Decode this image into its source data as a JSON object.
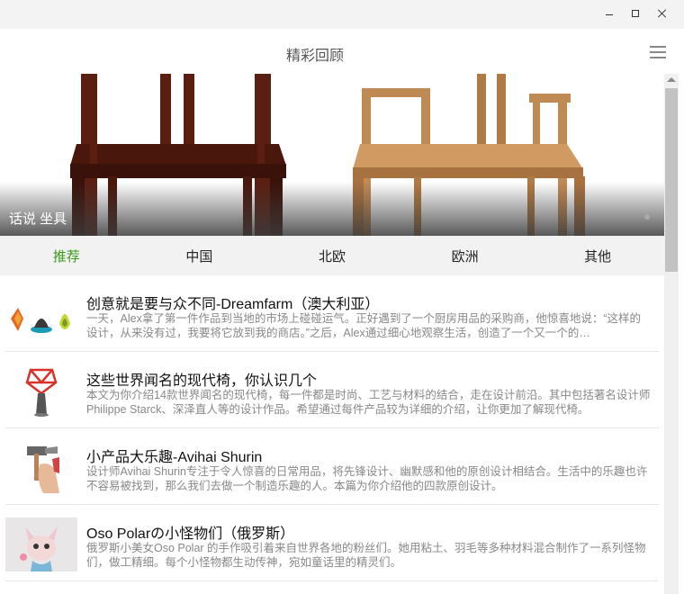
{
  "window": {
    "minimize_label": "–",
    "maximize_label": "□",
    "close_label": "×"
  },
  "header": {
    "title": "精彩回顾",
    "menu_icon": "hamburger-menu-icon"
  },
  "banner": {
    "caption": "话说 坐具",
    "image_subject": "two-wooden-chairs",
    "colors": {
      "dark_chair": "#5b1f12",
      "light_chair": "#c08a54"
    }
  },
  "tabs": [
    {
      "label": "推荐",
      "active": true
    },
    {
      "label": "中国",
      "active": false
    },
    {
      "label": "北欧",
      "active": false
    },
    {
      "label": "欧洲",
      "active": false
    },
    {
      "label": "其他",
      "active": false
    }
  ],
  "accent_color": "#3a9a1a",
  "articles": [
    {
      "title": "创意就是要与众不同-Dreamfarm（澳大利亚）",
      "desc": "一天，Alex拿了第一件作品到当地的市场上碰碰运气。正好遇到了一个厨房用品的采购商，他惊喜地说：“这样的设计，从来没有过，我要将它放到我的商店。”之后，Alex通过细心地观察生活，创造了一个又一个的…",
      "thumb_icon": "kitchen-gadgets-thumbnail"
    },
    {
      "title": "这些世界闻名的现代椅，你认识几个",
      "desc": "本文为你介绍14款世界闻名的现代椅，每一件都是时尚、工艺与材料的结合，走在设计前沿。其中包括著名设计师 Philippe Starck、深泽直人等的设计作品。希望通过每件产品较为详细的介绍，让你更加了解现代椅。",
      "thumb_icon": "red-chair-thumbnail"
    },
    {
      "title": "小产品大乐趣-Avihai Shurin",
      "desc": "设计师Avihai Shurin专注于令人惊喜的日常用品，将先锋设计、幽默感和他的原创设计相结合。生活中的乐趣也许不容易被找到，那么我们去做一个制造乐趣的人。本篇为你介绍他的四款原创设计。",
      "thumb_icon": "hammer-hand-thumbnail"
    },
    {
      "title": "Oso Polarの小怪物们（俄罗斯）",
      "desc": "俄罗斯小美女Oso Polar 的手作吸引着来自世界各地的粉丝们。她用粘土、羽毛等多种材料混合制作了一系列怪物们，做工精细。每个小怪物都生动传神，宛如童话里的精灵们。",
      "thumb_icon": "clay-monster-thumbnail"
    }
  ]
}
